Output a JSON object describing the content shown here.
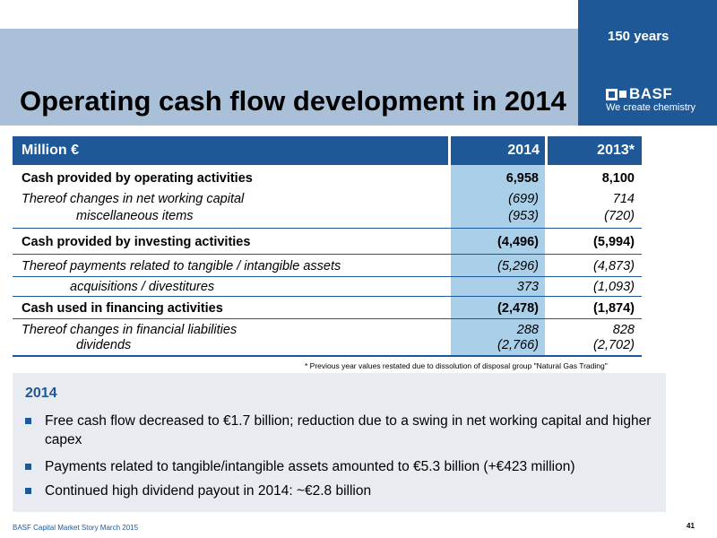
{
  "header": {
    "title": "Operating cash flow development in 2014",
    "anniversary": "150 years",
    "brand": "BASF",
    "tagline": "We create chemistry"
  },
  "table": {
    "headers": [
      "Million €",
      "2014",
      "2013*"
    ],
    "rows": [
      {
        "label": "Cash provided by operating activities",
        "v2014": "6,958",
        "v2013": "8,100"
      },
      {
        "label": "Thereof changes in net working capital",
        "v2014": "(699)",
        "v2013": "714"
      },
      {
        "label": "miscellaneous items",
        "v2014": "(953)",
        "v2013": "(720)"
      },
      {
        "label": "Cash provided by investing activities",
        "v2014": "(4,496)",
        "v2013": "(5,994)"
      },
      {
        "label": "Thereof  payments related to tangible / intangible assets",
        "v2014": "(5,296)",
        "v2013": "(4,873)"
      },
      {
        "label": "acquisitions / divestitures",
        "v2014": "373",
        "v2013": "(1,093)"
      },
      {
        "label": "Cash used in financing activities",
        "v2014": "(2,478)",
        "v2013": "(1,874)"
      },
      {
        "label": "Thereof changes in financial liabilities",
        "v2014": "288",
        "v2013": "828"
      },
      {
        "label": "dividends",
        "v2014": "(2,766)",
        "v2013": "(2,702)"
      }
    ],
    "footnote": "*   Previous year values restated due to dissolution of disposal group \"Natural Gas Trading\""
  },
  "summary": {
    "title": "2014",
    "bullets": [
      "Free cash flow decreased to €1.7 billion; reduction due to a swing in net working capital and higher capex",
      "Payments related to tangible/intangible assets amounted to €5.3 billion (+€423 million)",
      "Continued high dividend payout in 2014: ~€2.8 billion"
    ]
  },
  "footer": {
    "left": "BASF Capital Market Story March 2015",
    "page": "41"
  },
  "colors": {
    "brand_blue": "#1f5896",
    "header_light_blue": "#a9c0d8",
    "highlight_column": "#aacfe9",
    "summary_background": "#e8ebef"
  }
}
